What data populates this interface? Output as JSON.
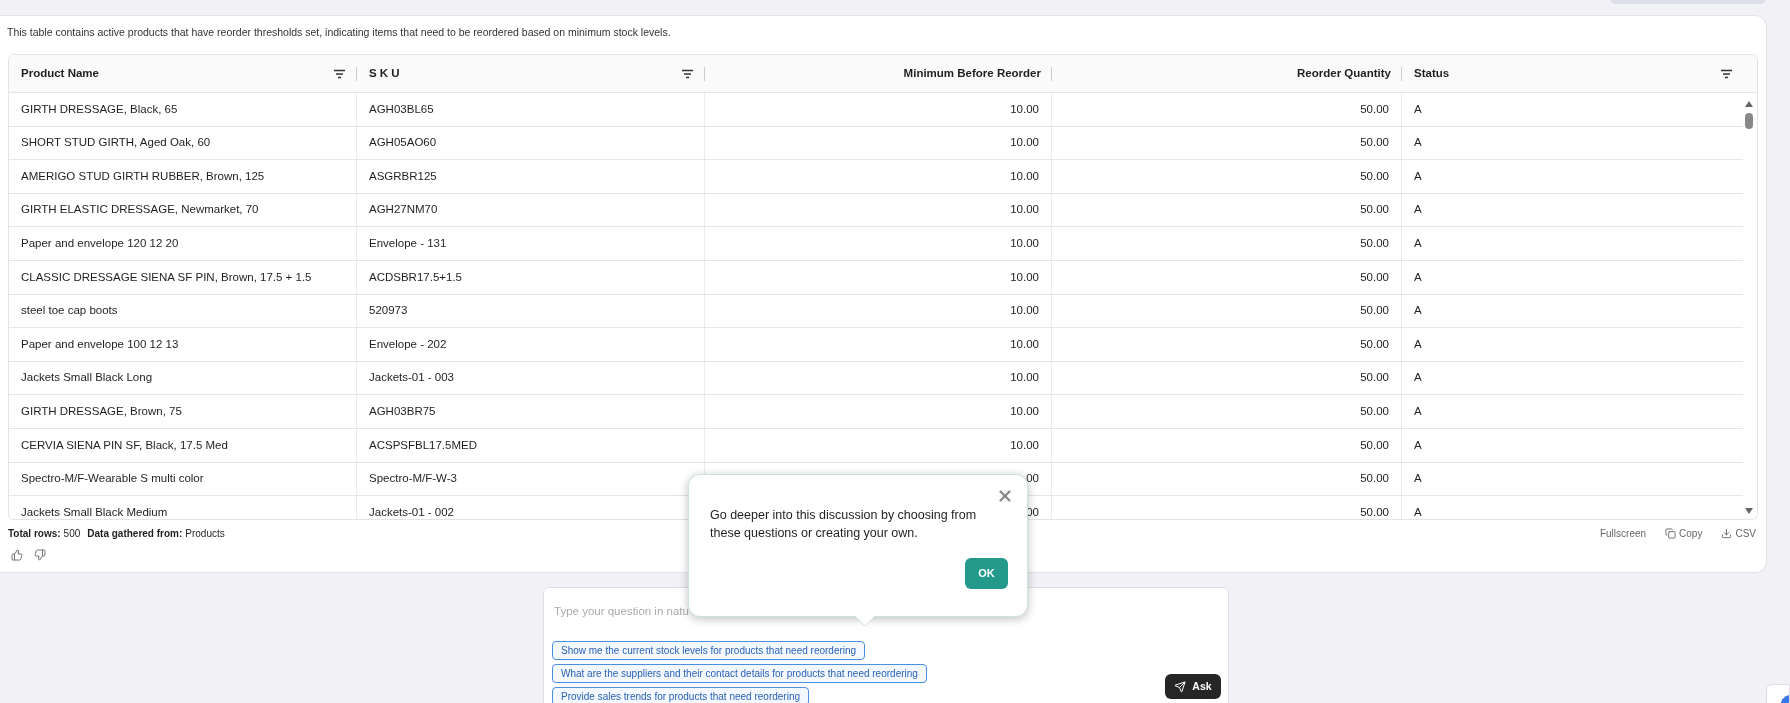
{
  "description": "This table contains active products that have reorder thresholds set, indicating items that need to be reordered based on minimum stock levels.",
  "table": {
    "columns": [
      {
        "label": "Product Name",
        "kind": "text",
        "filterable": true
      },
      {
        "label": "S K U",
        "kind": "text",
        "filterable": true
      },
      {
        "label": "Minimum Before Reorder",
        "kind": "number",
        "filterable": false
      },
      {
        "label": "Reorder Quantity",
        "kind": "number",
        "filterable": false
      },
      {
        "label": "Status",
        "kind": "text",
        "filterable": true
      }
    ],
    "rows": [
      [
        "GIRTH DRESSAGE, Black, 65",
        "AGH03BL65",
        "10.00",
        "50.00",
        "A"
      ],
      [
        "SHORT STUD GIRTH, Aged Oak, 60",
        "AGH05AO60",
        "10.00",
        "50.00",
        "A"
      ],
      [
        "AMERIGO STUD GIRTH RUBBER, Brown, 125",
        "ASGRBR125",
        "10.00",
        "50.00",
        "A"
      ],
      [
        "GIRTH ELASTIC DRESSAGE, Newmarket, 70",
        "AGH27NM70",
        "10.00",
        "50.00",
        "A"
      ],
      [
        "Paper and envelope 120 12 20",
        "Envelope - 131",
        "10.00",
        "50.00",
        "A"
      ],
      [
        "CLASSIC DRESSAGE SIENA SF PIN, Brown, 17.5 + 1.5",
        "ACDSBR17.5+1.5",
        "10.00",
        "50.00",
        "A"
      ],
      [
        "steel toe cap boots",
        "520973",
        "10.00",
        "50.00",
        "A"
      ],
      [
        "Paper and envelope 100 12 13",
        "Envelope - 202",
        "10.00",
        "50.00",
        "A"
      ],
      [
        "Jackets Small Black Long",
        "Jackets-01 - 003",
        "10.00",
        "50.00",
        "A"
      ],
      [
        "GIRTH DRESSAGE, Brown, 75",
        "AGH03BR75",
        "10.00",
        "50.00",
        "A"
      ],
      [
        "CERVIA SIENA PIN SF, Black, 17.5 Med",
        "ACSPSFBL17.5MED",
        "10.00",
        "50.00",
        "A"
      ],
      [
        "Spectro-M/F-Wearable S multi color",
        "Spectro-M/F-W-3",
        "00",
        "50.00",
        "A"
      ],
      [
        "Jackets Small Black Medium",
        "Jackets-01 - 002",
        "00",
        "50.00",
        "A"
      ]
    ]
  },
  "footer": {
    "total_label": "Total rows:",
    "total": "500",
    "source_label": "Data gathered from:",
    "source": "Products"
  },
  "actions": [
    {
      "kind": "fullscreen",
      "label": "Fullscreen"
    },
    {
      "kind": "copy",
      "label": "Copy"
    },
    {
      "kind": "csv",
      "label": "CSV"
    }
  ],
  "ask": {
    "placeholder": "Type your question in natu",
    "suggestions": [
      "Show me the current stock levels for products that need reordering",
      "What are the suppliers and their contact details for products that need reordering",
      "Provide sales trends for products that need reordering"
    ],
    "button": "Ask"
  },
  "popup": {
    "text": "Go deeper into this discussion by choosing from these questions or creating your own.",
    "ok": "OK"
  }
}
